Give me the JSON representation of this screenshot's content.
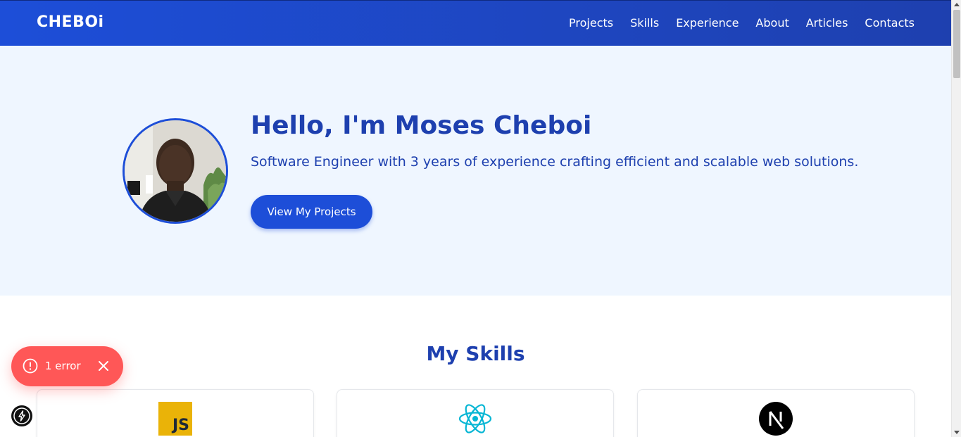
{
  "navbar": {
    "brand": "CHEBOi",
    "links": [
      "Projects",
      "Skills",
      "Experience",
      "About",
      "Articles",
      "Contacts"
    ]
  },
  "hero": {
    "title": "Hello, I'm Moses Cheboi",
    "subtitle": "Software Engineer with 3 years of experience crafting efficient and scalable web solutions.",
    "cta_label": "View My Projects"
  },
  "skills": {
    "title": "My Skills",
    "cards": [
      {
        "icon": "javascript-icon",
        "icon_text": "JS"
      },
      {
        "icon": "react-icon"
      },
      {
        "icon": "nextjs-icon"
      }
    ]
  },
  "error_toast": {
    "text": "1 error"
  },
  "colors": {
    "primary": "#1d4ed8",
    "primary_dark": "#1e40af",
    "hero_bg": "#eff6ff",
    "error": "#ff5757",
    "javascript": "#eab308",
    "react": "#06b6d4"
  }
}
